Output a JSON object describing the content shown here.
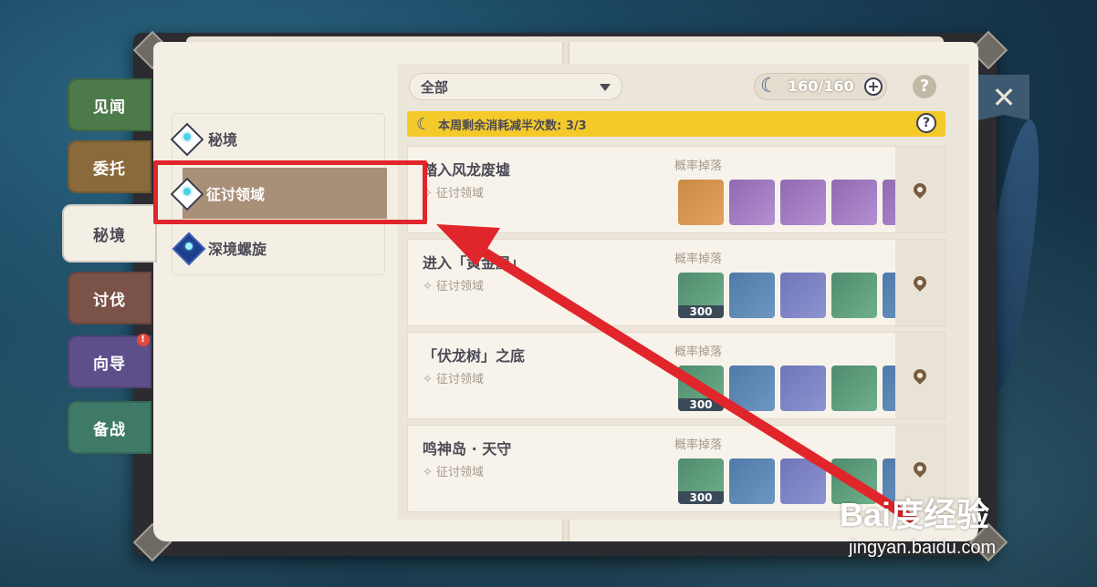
{
  "tabs": [
    {
      "label": "见闻",
      "color": "#4d7a4a"
    },
    {
      "label": "委托",
      "color": "#8a6a3a"
    },
    {
      "label": "秘境",
      "color": "#f4efe5",
      "active": true
    },
    {
      "label": "讨伐",
      "color": "#7a5248"
    },
    {
      "label": "向导",
      "color": "#5d4f8a",
      "badge": "!"
    },
    {
      "label": "备战",
      "color": "#3f7a68"
    }
  ],
  "categories": [
    {
      "label": "秘境",
      "icon": "domain-diamond-icon"
    },
    {
      "label": "征讨领域",
      "icon": "trounce-diamond-icon",
      "selected": true
    },
    {
      "label": "深境螺旋",
      "icon": "abyss-diamond-icon"
    }
  ],
  "filter": {
    "value": "全部"
  },
  "resin": {
    "text": "160/160",
    "plus": "+"
  },
  "help_mark": "?",
  "banner": {
    "text": "本周剩余消耗减半次数: 3/3",
    "color": "#f4c92a"
  },
  "domains": [
    {
      "title": "踏入风龙废墟",
      "sub": "征讨领域",
      "drops_label": "概率掉落",
      "items": [
        {
          "name": "character-card",
          "style": "orange"
        },
        {
          "name": "sword-item",
          "style": "purple"
        },
        {
          "name": "bow-item",
          "style": "purple"
        },
        {
          "name": "claymore-item",
          "style": "purple"
        },
        {
          "name": "extra-item",
          "style": "purple"
        }
      ]
    },
    {
      "title": "进入「黄金屋」",
      "sub": "征讨领域",
      "drops_label": "概率掉落",
      "items": [
        {
          "name": "adventure-exp-icon",
          "style": "green",
          "count": "300"
        },
        {
          "name": "mora-coin-icon",
          "style": "blue"
        },
        {
          "name": "crystal-icon",
          "style": "blueviolet"
        },
        {
          "name": "ore-icon",
          "style": "green"
        },
        {
          "name": "extra-item",
          "style": "blue"
        }
      ]
    },
    {
      "title": "「伏龙树」之底",
      "sub": "征讨领域",
      "drops_label": "概率掉落",
      "items": [
        {
          "name": "adventure-exp-icon",
          "style": "green",
          "count": "300"
        },
        {
          "name": "mora-coin-icon",
          "style": "blue"
        },
        {
          "name": "crystal-icon",
          "style": "blueviolet"
        },
        {
          "name": "ore-icon",
          "style": "green"
        },
        {
          "name": "extra-item",
          "style": "blue"
        }
      ]
    },
    {
      "title": "鸣神岛 · 天守",
      "sub": "征讨领域",
      "drops_label": "概率掉落",
      "items": [
        {
          "name": "adventure-exp-icon",
          "style": "green",
          "count": "300"
        },
        {
          "name": "mora-coin-icon",
          "style": "blue"
        },
        {
          "name": "crystal-icon",
          "style": "blueviolet"
        },
        {
          "name": "ore-icon",
          "style": "green"
        },
        {
          "name": "extra-item",
          "style": "blue"
        }
      ]
    }
  ],
  "close_symbol": "✕",
  "watermark": {
    "brand": "Bai度经验",
    "site": "jingyan.baidu.com"
  },
  "annotation_color": "#e0252b"
}
